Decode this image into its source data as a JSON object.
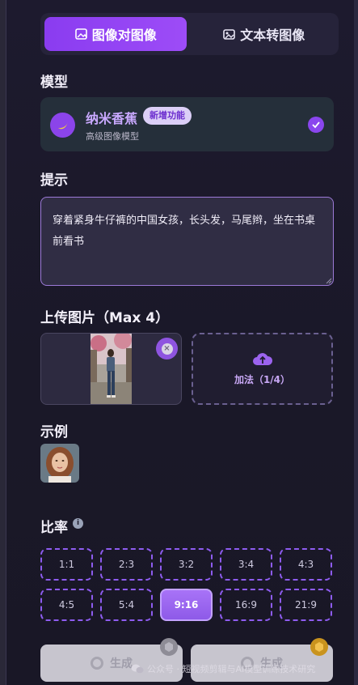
{
  "mode_tabs": [
    {
      "label": "图像对图像",
      "icon": "image-edit-icon",
      "active": true
    },
    {
      "label": "文本转图像",
      "icon": "text-image-icon",
      "active": false
    }
  ],
  "model": {
    "section_label": "模型",
    "name": "纳米香蕉",
    "badge": "新增功能",
    "description": "高级图像模型",
    "icon": "banana-icon",
    "selected": true
  },
  "prompt": {
    "section_label": "提示",
    "value": "穿着紧身牛仔裤的中国女孩，长头发，马尾辫，坐在书桌前看书"
  },
  "upload": {
    "section_label": "上传图片（Max 4）",
    "add_label": "加法（1/4）",
    "count": 1,
    "max": 4
  },
  "examples": {
    "section_label": "示例"
  },
  "ratio": {
    "section_label": "比率",
    "options": [
      "1:1",
      "2:3",
      "3:2",
      "3:4",
      "4:3",
      "4:5",
      "5:4",
      "9:16",
      "16:9",
      "21:9"
    ],
    "selected": "9:16"
  },
  "generate_buttons": [
    {
      "label": "生成",
      "badge": "silver-badge-icon"
    },
    {
      "label": "生成",
      "badge": "gold-badge-icon"
    }
  ],
  "watermark": "公众号 · 短视频剪辑与AI模型训练技术研究",
  "colors": {
    "accent": "#8a3cf0",
    "background": "#1d1a2e"
  }
}
